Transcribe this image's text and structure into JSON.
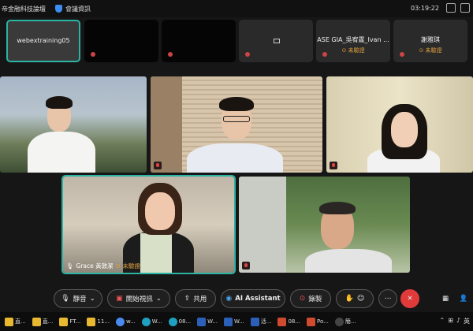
{
  "topbar": {
    "title": "帝金融科技論壇",
    "meeting_info": "會議資訊",
    "time": "03:19:22"
  },
  "strip": [
    {
      "name": "webextraining05",
      "sub": ""
    },
    {
      "name": "",
      "sub": ""
    },
    {
      "name": "",
      "sub": ""
    },
    {
      "name": "",
      "sub": ""
    },
    {
      "name": "ASE GIA_吳宥霆_Ivan ...",
      "sub": "⊙ 未驗證"
    },
    {
      "name": "謝雅琪",
      "sub": "⊙ 未驗證"
    }
  ],
  "tiles": {
    "grace_name": "Grace 黃敦潔",
    "grace_status": "⊙ 未驗證"
  },
  "controls": {
    "mute": "靜音",
    "video": "開始視訊",
    "share": "共用",
    "ai": "AI Assistant",
    "record": "錄製"
  },
  "taskbar": [
    {
      "label": "直...",
      "color": "#e8b830"
    },
    {
      "label": "直...",
      "color": "#e8b830"
    },
    {
      "label": "FT...",
      "color": "#e8b830"
    },
    {
      "label": "11...",
      "color": "#e8b830"
    },
    {
      "label": "w...",
      "color": "#4a8af0"
    },
    {
      "label": "W...",
      "color": "#20a0c0"
    },
    {
      "label": "08...",
      "color": "#20a0c0"
    },
    {
      "label": "W...",
      "color": "#2b5fb8"
    },
    {
      "label": "W...",
      "color": "#2b5fb8"
    },
    {
      "label": "活...",
      "color": "#2b5fb8"
    },
    {
      "label": "08...",
      "color": "#d04a30"
    },
    {
      "label": "Po...",
      "color": "#d04a30"
    },
    {
      "label": "簡...",
      "color": "#444"
    }
  ],
  "tray": {
    "lang": "英"
  }
}
